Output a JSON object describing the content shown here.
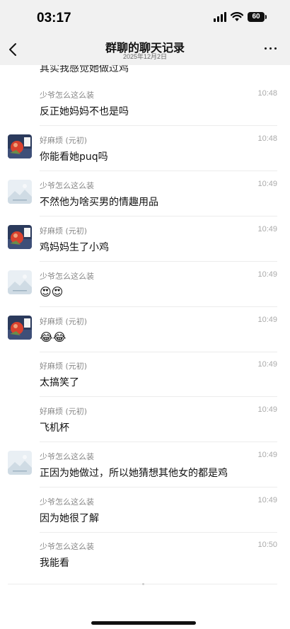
{
  "status_bar": {
    "time": "03:17",
    "battery": "60"
  },
  "nav": {
    "title": "群聊的聊天记录",
    "subtitle": "2025年12月2日"
  },
  "clipped_text": "其实我感觉她做过鸡",
  "messages": [
    {
      "sender": "少爷怎么这么装",
      "time": "10:48",
      "text": "反正她妈妈不也是吗",
      "avatar": "none"
    },
    {
      "sender": "好麻烦 (元初)",
      "time": "10:48",
      "text": "你能看她puq吗",
      "avatar": "photo"
    },
    {
      "sender": "少爷怎么这么装",
      "time": "10:49",
      "text": "不然他为啥买男的情趣用品",
      "avatar": "landscape"
    },
    {
      "sender": "好麻烦 (元初)",
      "time": "10:49",
      "text": "鸡妈妈生了小鸡",
      "avatar": "photo"
    },
    {
      "sender": "少爷怎么这么装",
      "time": "10:49",
      "text": "😍😍",
      "avatar": "landscape"
    },
    {
      "sender": "好麻烦 (元初)",
      "time": "10:49",
      "text": "😂😂",
      "avatar": "photo"
    },
    {
      "sender": "好麻烦 (元初)",
      "time": "10:49",
      "text": "太搞笑了",
      "avatar": "none"
    },
    {
      "sender": "好麻烦 (元初)",
      "time": "10:49",
      "text": "飞机杯",
      "avatar": "none"
    },
    {
      "sender": "少爷怎么这么装",
      "time": "10:49",
      "text": "正因为她做过，所以她猜想其他女的都是鸡",
      "avatar": "landscape"
    },
    {
      "sender": "少爷怎么这么装",
      "time": "10:49",
      "text": "因为她很了解",
      "avatar": "none"
    },
    {
      "sender": "少爷怎么这么装",
      "time": "10:50",
      "text": "我能看",
      "avatar": "none"
    }
  ]
}
